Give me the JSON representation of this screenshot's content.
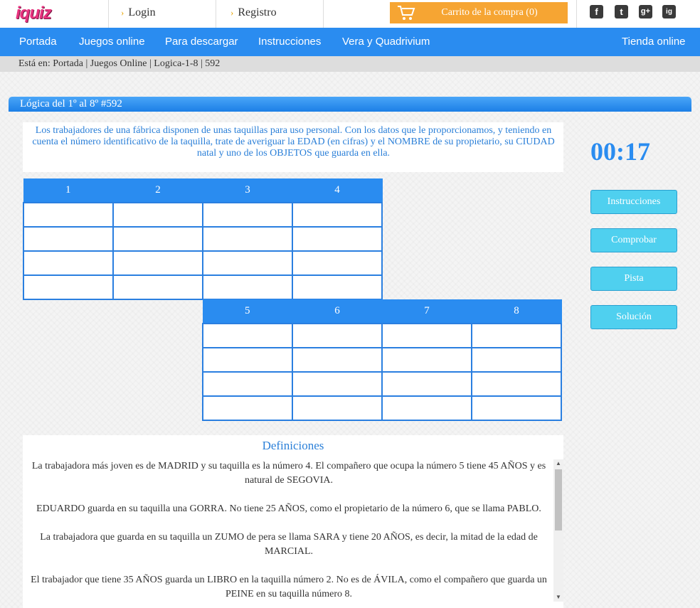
{
  "header": {
    "logo": "iquiz",
    "login": "Login",
    "registro": "Registro",
    "cart": "Carrito de la compra (0)",
    "social": [
      "f",
      "t",
      "g+",
      "ig"
    ]
  },
  "nav": {
    "items": [
      "Portada",
      "Juegos online",
      "Para descargar",
      "Instrucciones",
      "Vera y Quadrivium"
    ],
    "shop": "Tienda online"
  },
  "breadcrumb": "Está en: Portada | Juegos Online | Logica-1-8 | 592",
  "puzzle": {
    "title": "Lógica del 1º al 8º #592",
    "intro": "Los trabajadores de una fábrica disponen de unas taquillas para uso personal. Con los datos que le proporcionamos, y teniendo en cuenta el número identificativo de la taquilla, trate de averiguar la EDAD (en cifras) y el NOMBRE de su propietario, su CIUDAD natal y uno de los OBJETOS que guarda en ella.",
    "grid_top": [
      "1",
      "2",
      "3",
      "4"
    ],
    "grid_bottom": [
      "5",
      "6",
      "7",
      "8"
    ]
  },
  "sidebar": {
    "timer": "00:17",
    "buttons": [
      "Instrucciones",
      "Comprobar",
      "Pista",
      "Solución"
    ]
  },
  "definitions": {
    "title": "Definiciones",
    "items": [
      "La trabajadora más joven es de MADRID y su taquilla es la número 4. El compañero que ocupa la número 5 tiene 45 AÑOS y es natural de SEGOVIA.",
      "EDUARDO guarda en su taquilla una GORRA. No tiene 25 AÑOS, como el propietario de la número 6, que se llama PABLO.",
      "La trabajadora que guarda en su taquilla un ZUMO de pera se llama SARA y tiene 20 AÑOS, es decir, la mitad de la edad de MARCIAL.",
      "El trabajador que tiene 35 AÑOS guarda un LIBRO en la taquilla número 2. No es de ÁVILA, como el compañero que guarda un PEINE en su taquilla número 8."
    ]
  },
  "colors": {
    "accent": "#2a8cf0",
    "cart": "#f6a533",
    "button": "#4fd0ef",
    "logo": "#e8327f"
  }
}
